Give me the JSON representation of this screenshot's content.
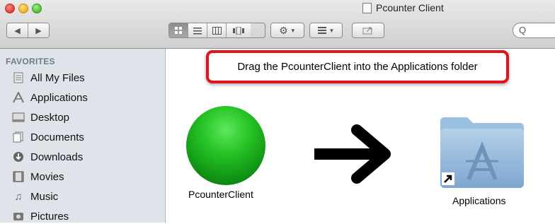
{
  "window": {
    "title": "Pcounter Client"
  },
  "toolbar": {
    "nav": [
      "◀",
      "▶"
    ],
    "view_buttons": [
      "icon-view",
      "list-view",
      "column-view",
      "coverflow-view"
    ],
    "action_button": "gear",
    "arrange_button": "arrange",
    "share_button": "share",
    "search_icon": "Q"
  },
  "sidebar": {
    "heading": "FAVORITES",
    "items": [
      {
        "label": "All My Files",
        "icon": "all-files-icon"
      },
      {
        "label": "Applications",
        "icon": "applications-icon"
      },
      {
        "label": "Desktop",
        "icon": "desktop-icon"
      },
      {
        "label": "Documents",
        "icon": "documents-icon"
      },
      {
        "label": "Downloads",
        "icon": "downloads-icon"
      },
      {
        "label": "Movies",
        "icon": "movies-icon"
      },
      {
        "label": "Music",
        "icon": "music-icon"
      },
      {
        "label": "Pictures",
        "icon": "pictures-icon"
      }
    ]
  },
  "content": {
    "instruction": "Drag the PcounterClient into the Applications folder",
    "source_label": "PcounterClient",
    "target_label": "Applications"
  },
  "colors": {
    "banner_border": "#e0141b",
    "sidebar_bg": "#dee4ea",
    "ball_green": "#26c426",
    "folder_blue": "#8fb6d9"
  }
}
